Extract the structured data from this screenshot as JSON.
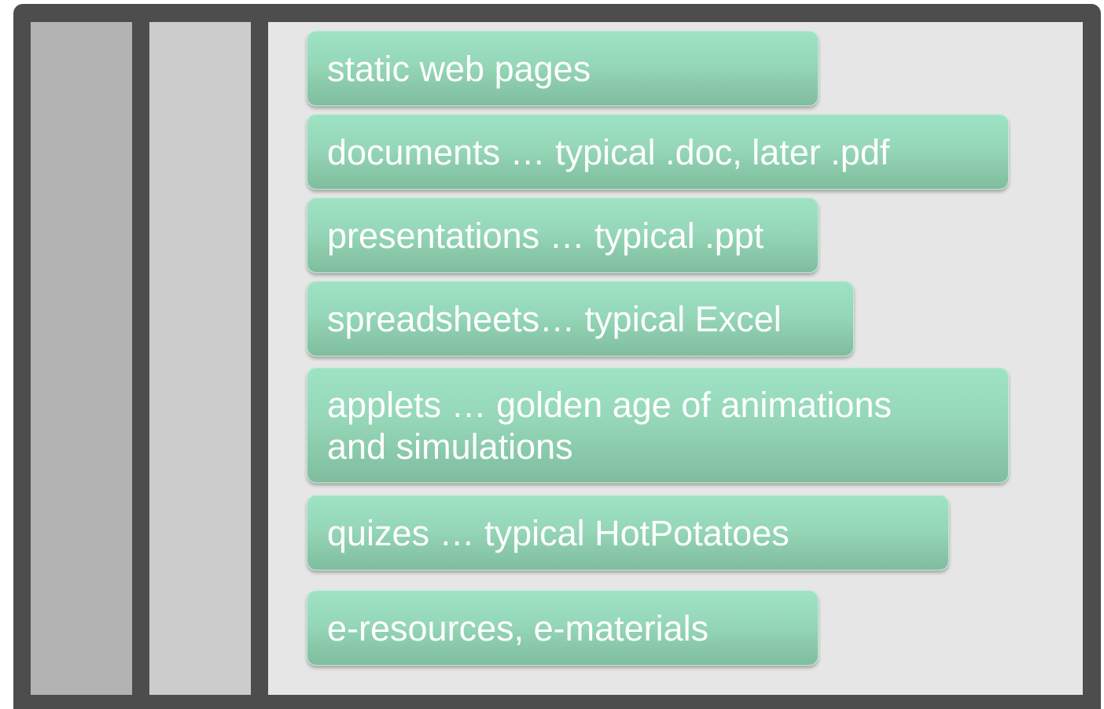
{
  "items": [
    {
      "label": "static web pages"
    },
    {
      "label": "documents … typical .doc, later .pdf"
    },
    {
      "label": "presentations … typical .ppt"
    },
    {
      "label": "spreadsheets… typical Excel"
    },
    {
      "label": "applets … golden age of animations and simulations"
    },
    {
      "label": "quizes … typical HotPotatoes"
    },
    {
      "label": "e-resources, e-materials"
    }
  ],
  "colors": {
    "frame": "#4d4d4d",
    "column_1": "#b3b3b3",
    "column_2": "#cccccc",
    "column_3": "#e6e6e6",
    "card_top": "#9ee3c4",
    "card_bottom": "#7fbd9e",
    "card_text": "#ffffff"
  }
}
